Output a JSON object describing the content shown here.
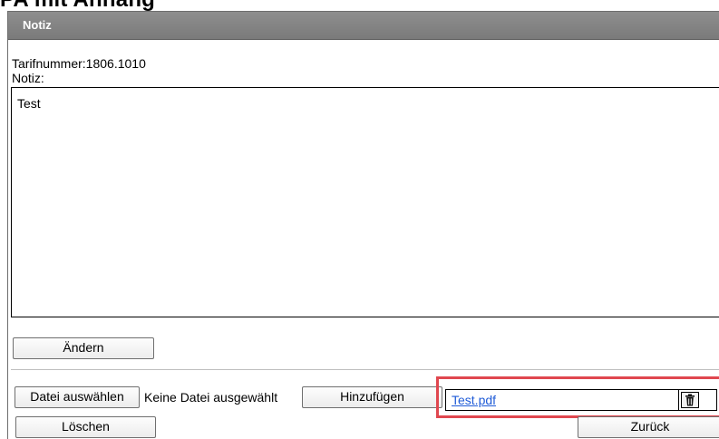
{
  "page": {
    "title": "PA mit Anhang"
  },
  "panel": {
    "header_title": "Notiz",
    "tarif_line": "Tarifnummer:1806.1010",
    "notiz_label": "Notiz:"
  },
  "note": {
    "value": "Test"
  },
  "buttons": {
    "aendern": "Ändern",
    "datei_auswaehlen": "Datei auswählen",
    "hinzufuegen": "Hinzufügen",
    "loeschen": "Löschen",
    "zurueck": "Zurück"
  },
  "file_input": {
    "status": "Keine Datei ausgewählt"
  },
  "attachment": {
    "name": "Test.pdf",
    "delete_icon": "trash-icon"
  },
  "colors": {
    "header_bg": "#7f7f7f",
    "highlight": "#e0474f",
    "link": "#1f5bd7"
  }
}
